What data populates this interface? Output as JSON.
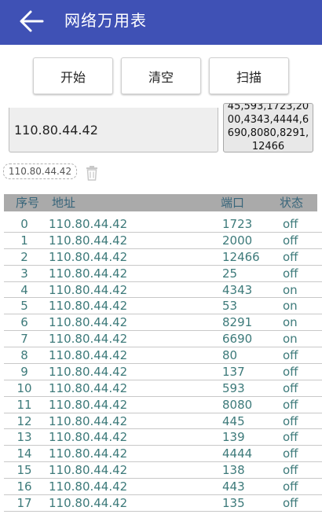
{
  "app": {
    "title": "网络万用表"
  },
  "colors": {
    "appbar": "#3f51b5",
    "table_header": "#aaaaaa",
    "table_text": "#3d7a7a"
  },
  "toolbar": {
    "start_label": "开始",
    "clear_label": "清空",
    "scan_label": "扫描"
  },
  "ip_input": {
    "value": "110.80.44.42"
  },
  "ports_input": {
    "value": "45,593,1723,2000,4343,4444,6690,8080,8291,12466"
  },
  "history": {
    "chip": "110.80.44.42"
  },
  "table": {
    "headers": {
      "index": "序号",
      "address": "地址",
      "port": "端口",
      "status": "状态"
    },
    "rows": [
      {
        "index": "0",
        "address": "110.80.44.42",
        "port": "1723",
        "status": "off"
      },
      {
        "index": "1",
        "address": "110.80.44.42",
        "port": "2000",
        "status": "off"
      },
      {
        "index": "2",
        "address": "110.80.44.42",
        "port": "12466",
        "status": "off"
      },
      {
        "index": "3",
        "address": "110.80.44.42",
        "port": "25",
        "status": "off"
      },
      {
        "index": "4",
        "address": "110.80.44.42",
        "port": "4343",
        "status": "on"
      },
      {
        "index": "5",
        "address": "110.80.44.42",
        "port": "53",
        "status": "on"
      },
      {
        "index": "6",
        "address": "110.80.44.42",
        "port": "8291",
        "status": "on"
      },
      {
        "index": "7",
        "address": "110.80.44.42",
        "port": "6690",
        "status": "on"
      },
      {
        "index": "8",
        "address": "110.80.44.42",
        "port": "80",
        "status": "off"
      },
      {
        "index": "9",
        "address": "110.80.44.42",
        "port": "137",
        "status": "off"
      },
      {
        "index": "10",
        "address": "110.80.44.42",
        "port": "593",
        "status": "off"
      },
      {
        "index": "11",
        "address": "110.80.44.42",
        "port": "8080",
        "status": "off"
      },
      {
        "index": "12",
        "address": "110.80.44.42",
        "port": "445",
        "status": "off"
      },
      {
        "index": "13",
        "address": "110.80.44.42",
        "port": "139",
        "status": "off"
      },
      {
        "index": "14",
        "address": "110.80.44.42",
        "port": "4444",
        "status": "off"
      },
      {
        "index": "15",
        "address": "110.80.44.42",
        "port": "138",
        "status": "off"
      },
      {
        "index": "16",
        "address": "110.80.44.42",
        "port": "443",
        "status": "off"
      },
      {
        "index": "17",
        "address": "110.80.44.42",
        "port": "135",
        "status": "off"
      }
    ]
  },
  "icons": {
    "back": "arrow-back-icon",
    "delete": "trash-icon"
  }
}
